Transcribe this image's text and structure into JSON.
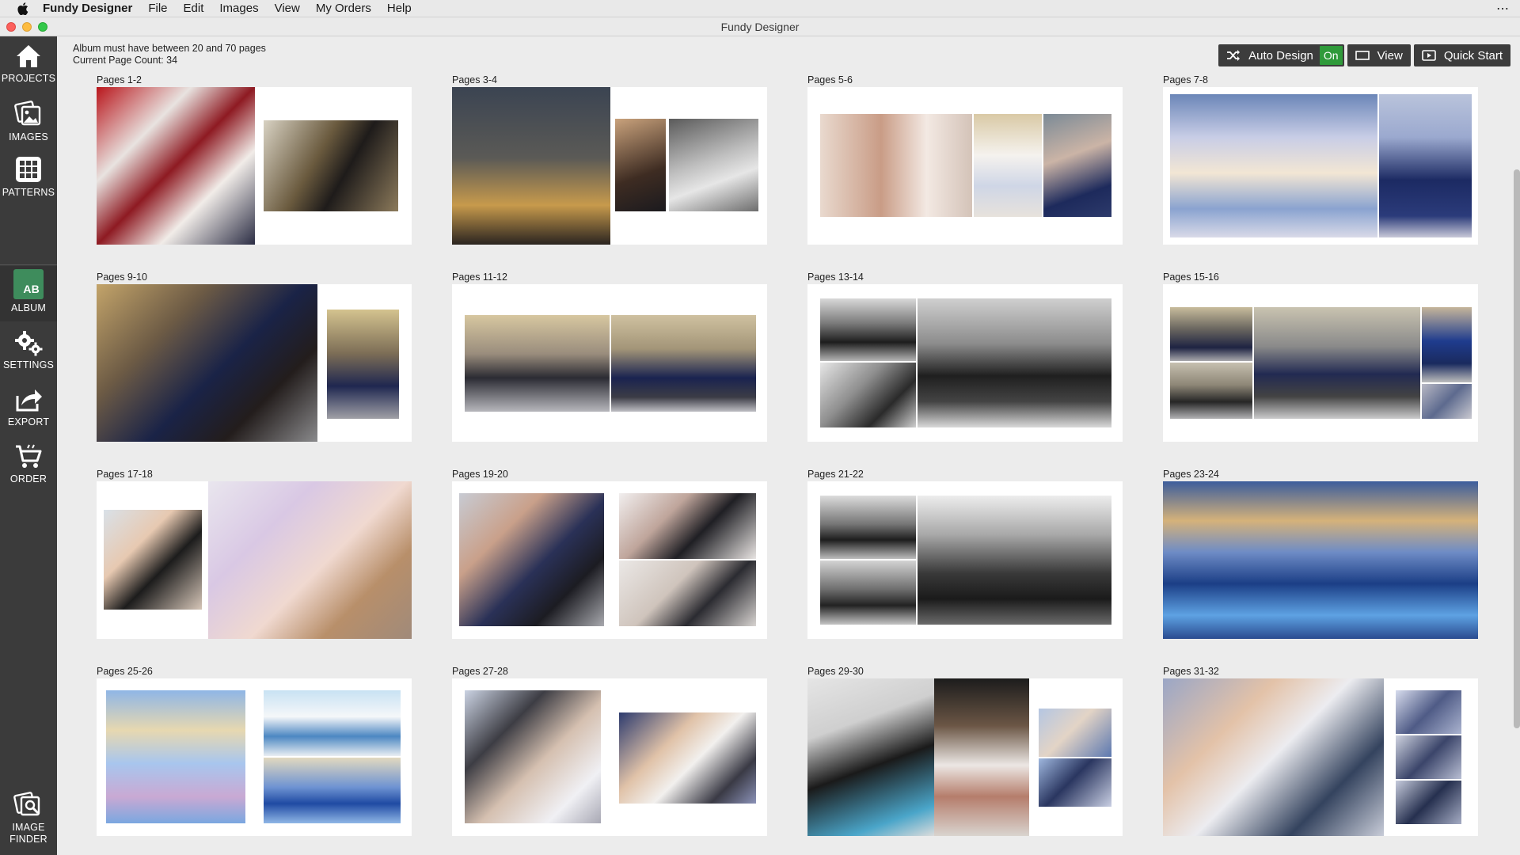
{
  "menubar": {
    "app_name": "Fundy Designer",
    "items": [
      "File",
      "Edit",
      "Images",
      "View",
      "My Orders",
      "Help"
    ]
  },
  "window": {
    "title": "Fundy Designer"
  },
  "sidebar": {
    "items": [
      {
        "label": "PROJECTS",
        "icon": "home-icon"
      },
      {
        "label": "IMAGES",
        "icon": "images-icon"
      },
      {
        "label": "PATTERNS",
        "icon": "patterns-grid-icon"
      },
      {
        "label": "ALBUM",
        "icon": "album-ab-icon",
        "badge": "AB",
        "selected": true
      },
      {
        "label": "SETTINGS",
        "icon": "gears-icon"
      },
      {
        "label": "EXPORT",
        "icon": "share-export-icon"
      },
      {
        "label": "ORDER",
        "icon": "cart-icon"
      }
    ],
    "bottom": {
      "label_line1": "IMAGE",
      "label_line2": "FINDER",
      "icon": "image-finder-icon"
    }
  },
  "info": {
    "line1": "Album must have between 20 and 70 pages",
    "line2": "Current Page Count: 34"
  },
  "toolbar": {
    "auto_design_label": "Auto Design",
    "auto_design_state": "On",
    "view_label": "View",
    "quick_start_label": "Quick Start",
    "accent_on": "#2f9a3a"
  },
  "spreads": [
    {
      "label": "Pages 1-2"
    },
    {
      "label": "Pages 3-4"
    },
    {
      "label": "Pages 5-6"
    },
    {
      "label": "Pages 7-8"
    },
    {
      "label": "Pages 9-10"
    },
    {
      "label": "Pages 11-12"
    },
    {
      "label": "Pages 13-14"
    },
    {
      "label": "Pages 15-16"
    },
    {
      "label": "Pages 17-18"
    },
    {
      "label": "Pages 19-20"
    },
    {
      "label": "Pages 21-22"
    },
    {
      "label": "Pages 23-24"
    },
    {
      "label": "Pages 25-26"
    },
    {
      "label": "Pages 27-28"
    },
    {
      "label": "Pages 29-30"
    },
    {
      "label": "Pages 31-32"
    }
  ]
}
